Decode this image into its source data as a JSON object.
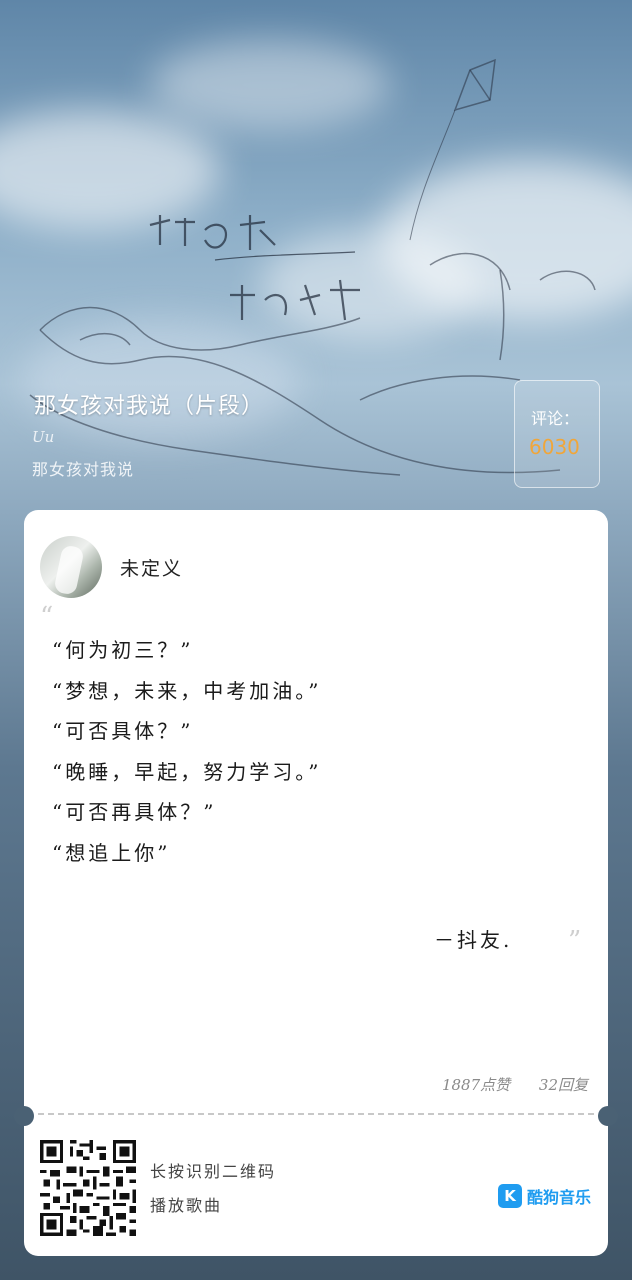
{
  "song": {
    "title": "那女孩对我说（片段）",
    "artist": "Uu",
    "album": "那女孩对我说"
  },
  "comments_badge": {
    "label": "评论：",
    "count": "6030"
  },
  "comment": {
    "username": "未定义",
    "quote_open": "“",
    "lines": [
      "“何为初三？”",
      "“梦想，未来，中考加油。”",
      "“可否具体？”",
      "“晚睡，早起，努力学习。”",
      "“可否再具体？”",
      "“想追上你”"
    ],
    "signature": "－抖友.",
    "quote_close": "”",
    "likes": "1887点赞",
    "replies": "32回复"
  },
  "footer": {
    "hint_line1": "长按识别二维码",
    "hint_line2": "播放歌曲",
    "brand_icon": "K",
    "brand_name": "酷狗音乐",
    "brand_color": "#1f9cf0"
  },
  "colors": {
    "accent": "#f0a63a"
  }
}
